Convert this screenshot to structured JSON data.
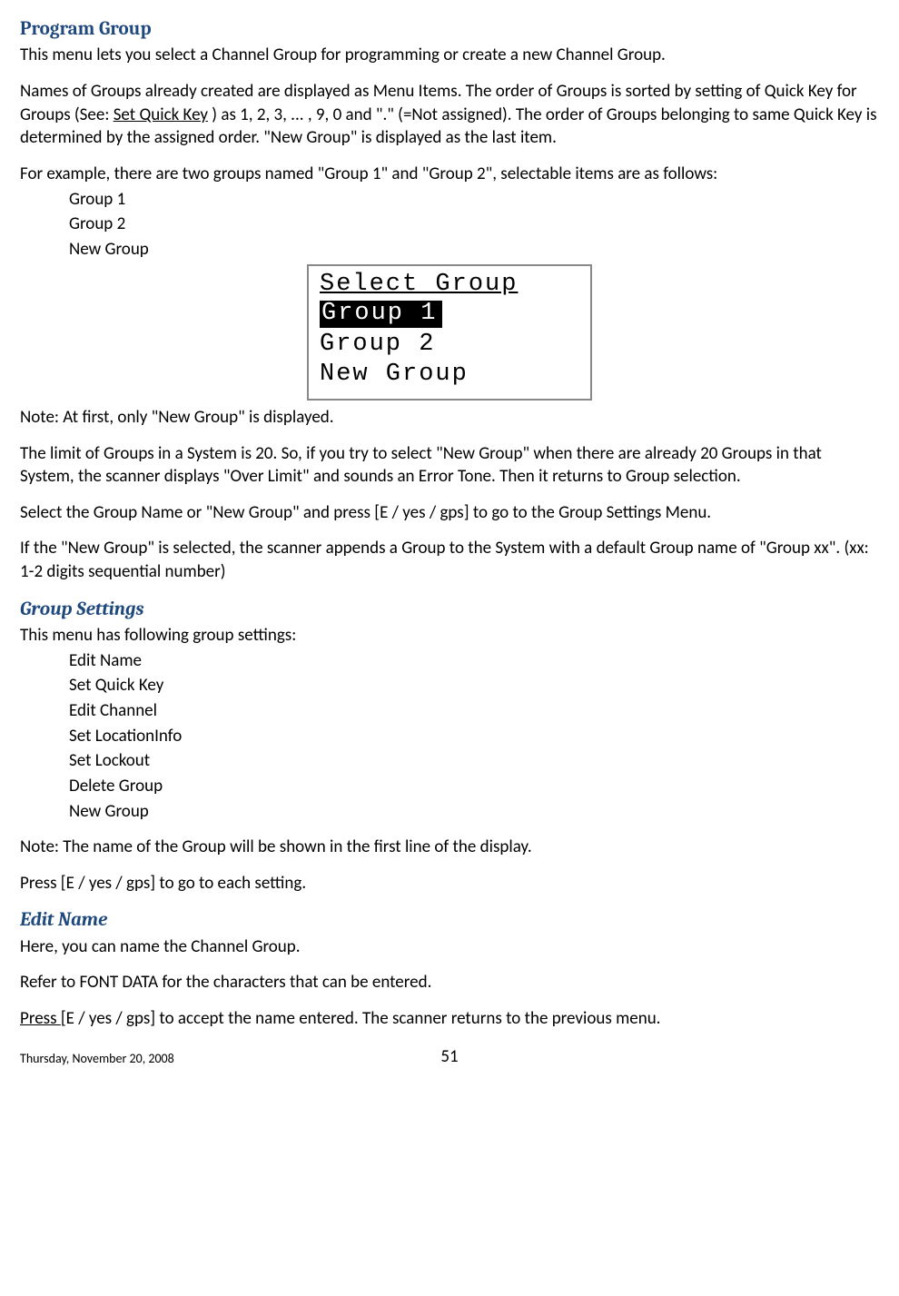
{
  "sections": {
    "programGroup": {
      "title": "Program Group",
      "p1": "This menu lets you select a Channel Group for programming or create a new Channel Group.",
      "p2a": "Names of Groups already created are displayed as Menu Items. The order of Groups is sorted by setting of Quick Key for Groups (See: ",
      "p2link": "Set Quick Key",
      "p2b": " ) as 1, 2, 3, ... , 9, 0 and \".\" (=Not assigned). The order of Groups belonging to same Quick Key is determined by the assigned order. \"New Group\" is displayed as the last item.",
      "p3": "For example, there are two groups named \"Group 1\" and \"Group 2\", selectable items are as follows:",
      "exampleItems": [
        "Group 1",
        "Group 2",
        "New Group"
      ],
      "lcd": {
        "title": "Select Group",
        "rows": [
          "Group 1",
          "Group 2",
          "New Group"
        ],
        "selectedIndex": 0
      },
      "note1": "Note: At first, only \"New Group\" is displayed.",
      "p4": "The limit of Groups in a System is 20. So, if you try to select \"New Group\" when there are already 20 Groups in that System, the scanner displays \"Over Limit\" and sounds an Error Tone. Then it returns to Group selection.",
      "p5": "Select the Group Name or \"New Group\" and press [E / yes / gps] to go to the Group Settings Menu.",
      "p6": "If the \"New Group\" is selected, the scanner appends a Group to the System with a default Group name of \"Group xx\". (xx: 1-2 digits sequential number)"
    },
    "groupSettings": {
      "title": "Group Settings",
      "intro": "This menu has following group settings:",
      "items": [
        "Edit Name",
        "Set Quick Key",
        "Edit Channel",
        "Set LocationInfo",
        "Set Lockout",
        "Delete Group",
        "New Group"
      ],
      "note": "Note: The name of the Group will be shown in the first line of the display.",
      "press": "Press [E / yes / gps] to go to each setting."
    },
    "editName": {
      "title": "Edit Name",
      "p1": "Here, you can name the Channel Group.",
      "p2": "Refer to FONT DATA for the characters that can be entered.",
      "p3pre": "Press ",
      "p3rest": "[E / yes / gps] to accept the name entered. The scanner returns to the previous menu."
    }
  },
  "footer": {
    "date": "Thursday, November 20, 2008",
    "page": "51"
  }
}
